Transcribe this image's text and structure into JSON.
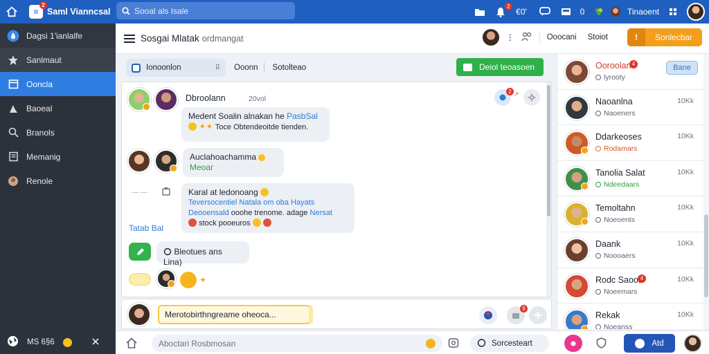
{
  "topbar": {
    "app_name": "Saml Vianncsal",
    "app_badge": "2",
    "search_placeholder": "Sooal als Isale",
    "notif_badge": "2",
    "notif_count": "€0'",
    "messages_count": "0",
    "user_name": "Tinaoent"
  },
  "sidebar": {
    "items": [
      {
        "label": "Dagsi 1'ianlalfe",
        "icon": "water-drop-icon"
      },
      {
        "label": "Sanlmaut",
        "icon": "star-icon"
      },
      {
        "label": "Ooncla",
        "icon": "calendar-icon"
      },
      {
        "label": "Baoeal",
        "icon": "tool-icon"
      },
      {
        "label": "Branols",
        "icon": "search-icon"
      },
      {
        "label": "Memanig",
        "icon": "document-icon"
      },
      {
        "label": "Renole",
        "icon": "face-icon"
      }
    ],
    "footer_text": "MS 6§6"
  },
  "header": {
    "title": "Sosgai Mlatak",
    "subtitle": "ordmangat",
    "label1": "Ooocani",
    "label2": "Stoiot",
    "connect_label": "Sonlecbar"
  },
  "toolbar": {
    "segment_label": "Ionoonlon",
    "item1": "Ooonn",
    "item2": "Sotolteao",
    "primary_label": "Deiol teoasoen"
  },
  "chat": {
    "header_author": "Dbroolann",
    "header_meta": "20vol",
    "header_badge": "2",
    "messages": [
      {
        "line1_a": "Medent Soalin alnakan he",
        "line1_b": "PasbSal",
        "line2": "Toce Obtendeoitde tienden."
      },
      {
        "line1": "Auclahoachamma",
        "line2": "Meoar"
      },
      {
        "line1": "Karal at ledonoang",
        "line2_a": "Teversocentiel",
        "line2_b": "Natala om oba Hayats",
        "line3_a": "Deooensald",
        "line3_b": "ooohe trenome. adage",
        "line3_c": "Nersat",
        "line4": "stock pooeuros"
      }
    ],
    "side_label": "Tatab Bal",
    "small_msg": "Bleotues ans Lina)"
  },
  "composer": {
    "placeholder": "Merotobirthngreame oheoca...",
    "badge": "9"
  },
  "bottombar": {
    "placeholder": "Aboctari Rosbmosan",
    "search_label": "Sorcesteart",
    "share_label": "Atd"
  },
  "contacts": [
    {
      "name": "Ooroolan",
      "status": "lyrooty",
      "time": "",
      "follow": "Bane",
      "unread": "4",
      "status_color": "default"
    },
    {
      "name": "Naoanlna",
      "status": "Naoeners",
      "time": "10Kk",
      "status_color": "default"
    },
    {
      "name": "Ddarkeoses",
      "status": "Rodamars",
      "time": "10Kk",
      "status_color": "orange"
    },
    {
      "name": "Tanolia Salat",
      "status": "Ndeedaars",
      "time": "10Kk",
      "status_color": "green"
    },
    {
      "name": "Temoltahn",
      "status": "Noeoents",
      "time": "10Kk",
      "status_color": "default"
    },
    {
      "name": "Daank",
      "status": "Noooaers",
      "time": "10Kk",
      "status_color": "default"
    },
    {
      "name": "Rodc Saooa",
      "status": "Noeemars",
      "time": "10Kk",
      "unread": "4",
      "status_color": "default"
    },
    {
      "name": "Rekak",
      "status": "Noeanss",
      "time": "10Kk",
      "status_color": "default"
    }
  ],
  "colors": {
    "topbar": "#1f5fbf",
    "sidebar": "#2c323b",
    "sidebar_active": "#2f7de0",
    "accent_orange": "#f59e1a",
    "accent_green": "#2fb04a"
  }
}
